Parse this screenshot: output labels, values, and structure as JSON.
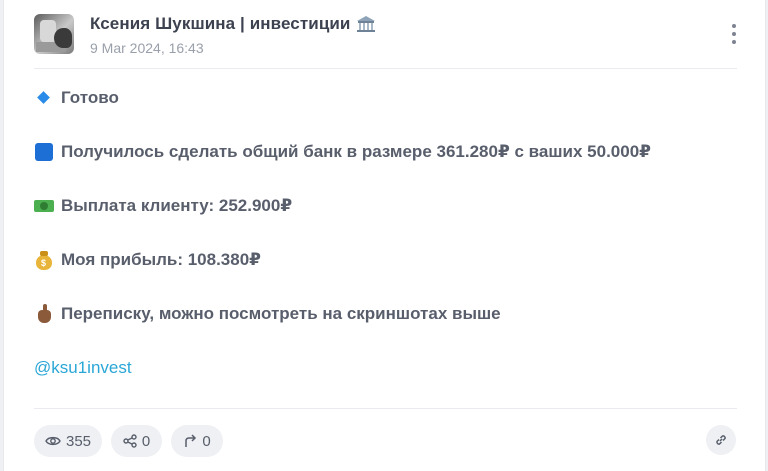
{
  "post": {
    "channel_name": "Ксения Шукшина | инвестиции",
    "date": "9 Мar 2024, 16:43",
    "lines": [
      {
        "icon": "blue-diamond-icon",
        "text": "Готово"
      },
      {
        "icon": "blue-square-icon",
        "text": "Получилось сделать общий банк в размере 361.280₽ с ваших 50.000₽"
      },
      {
        "icon": "money-banknote-icon",
        "text": "Выплата клиенту: 252.900₽"
      },
      {
        "icon": "money-bag-icon",
        "text": "Моя прибыль: 108.380₽"
      },
      {
        "icon": "pointing-hand-icon",
        "text": "Переписку, можно посмотреть на скриншотах выше"
      }
    ],
    "mention": "@ksu1invest"
  },
  "footer": {
    "views": "355",
    "shares": "0",
    "forwards": "0"
  },
  "icons": {
    "title_icon": "bank-icon",
    "menu": "more-vertical-icon",
    "views": "eye-icon",
    "shares": "share-icon",
    "forwards": "forward-arrow-icon",
    "copy_link": "link-icon"
  },
  "colors": {
    "text": "#585e6b",
    "muted": "#9aa0ab",
    "link": "#2aa7d6",
    "pill_bg": "#eef0f3"
  }
}
